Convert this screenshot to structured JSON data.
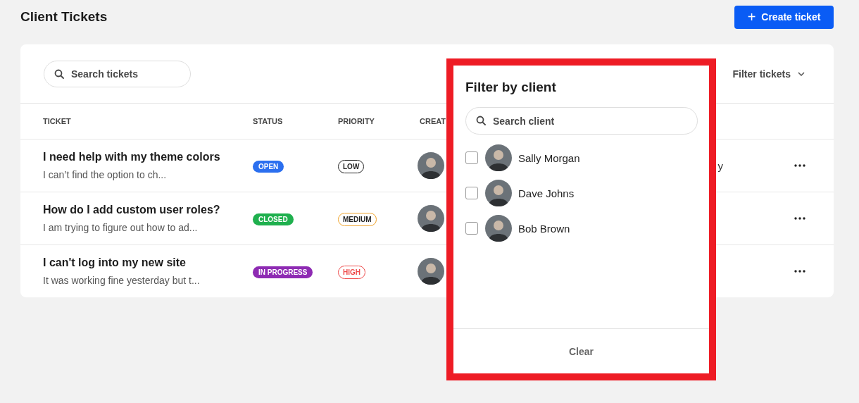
{
  "title": "Client Tickets",
  "create_button": {
    "label": "Create ticket",
    "icon": "+"
  },
  "search": {
    "placeholder": "Search tickets"
  },
  "filter_menu": {
    "label": "Filter tickets"
  },
  "table": {
    "columns": [
      "TICKET",
      "STATUS",
      "PRIORITY",
      "CREAT"
    ],
    "rows": [
      {
        "title": "I need help with my theme colors",
        "excerpt": "I can’t find the option to ch...",
        "status": {
          "label": "OPEN",
          "color": "#2b6fef"
        },
        "priority": {
          "label": "LOW",
          "color": "#222222"
        },
        "column_5": "y"
      },
      {
        "title": "How do I add custom user roles?",
        "excerpt": "I am trying to figure out how to ad...",
        "status": {
          "label": "CLOSED",
          "color": "#1fb04e"
        },
        "priority": {
          "label": "MEDIUM",
          "color": "#f0a32a"
        }
      },
      {
        "title": "I can't log into my new site",
        "excerpt": "It was working fine yesterday but t...",
        "status": {
          "label": "IN PROGRESS",
          "color": "#8e2bb3"
        },
        "priority": {
          "label": "HIGH",
          "color": "#ee4b4b"
        }
      }
    ]
  },
  "client_filter": {
    "title": "Filter by client",
    "search_placeholder": "Search client",
    "clients": [
      {
        "name": "Sally Morgan",
        "checked": false
      },
      {
        "name": "Dave Johns",
        "checked": false
      },
      {
        "name": "Bob Brown",
        "checked": false
      }
    ],
    "clear_button": "Clear"
  }
}
